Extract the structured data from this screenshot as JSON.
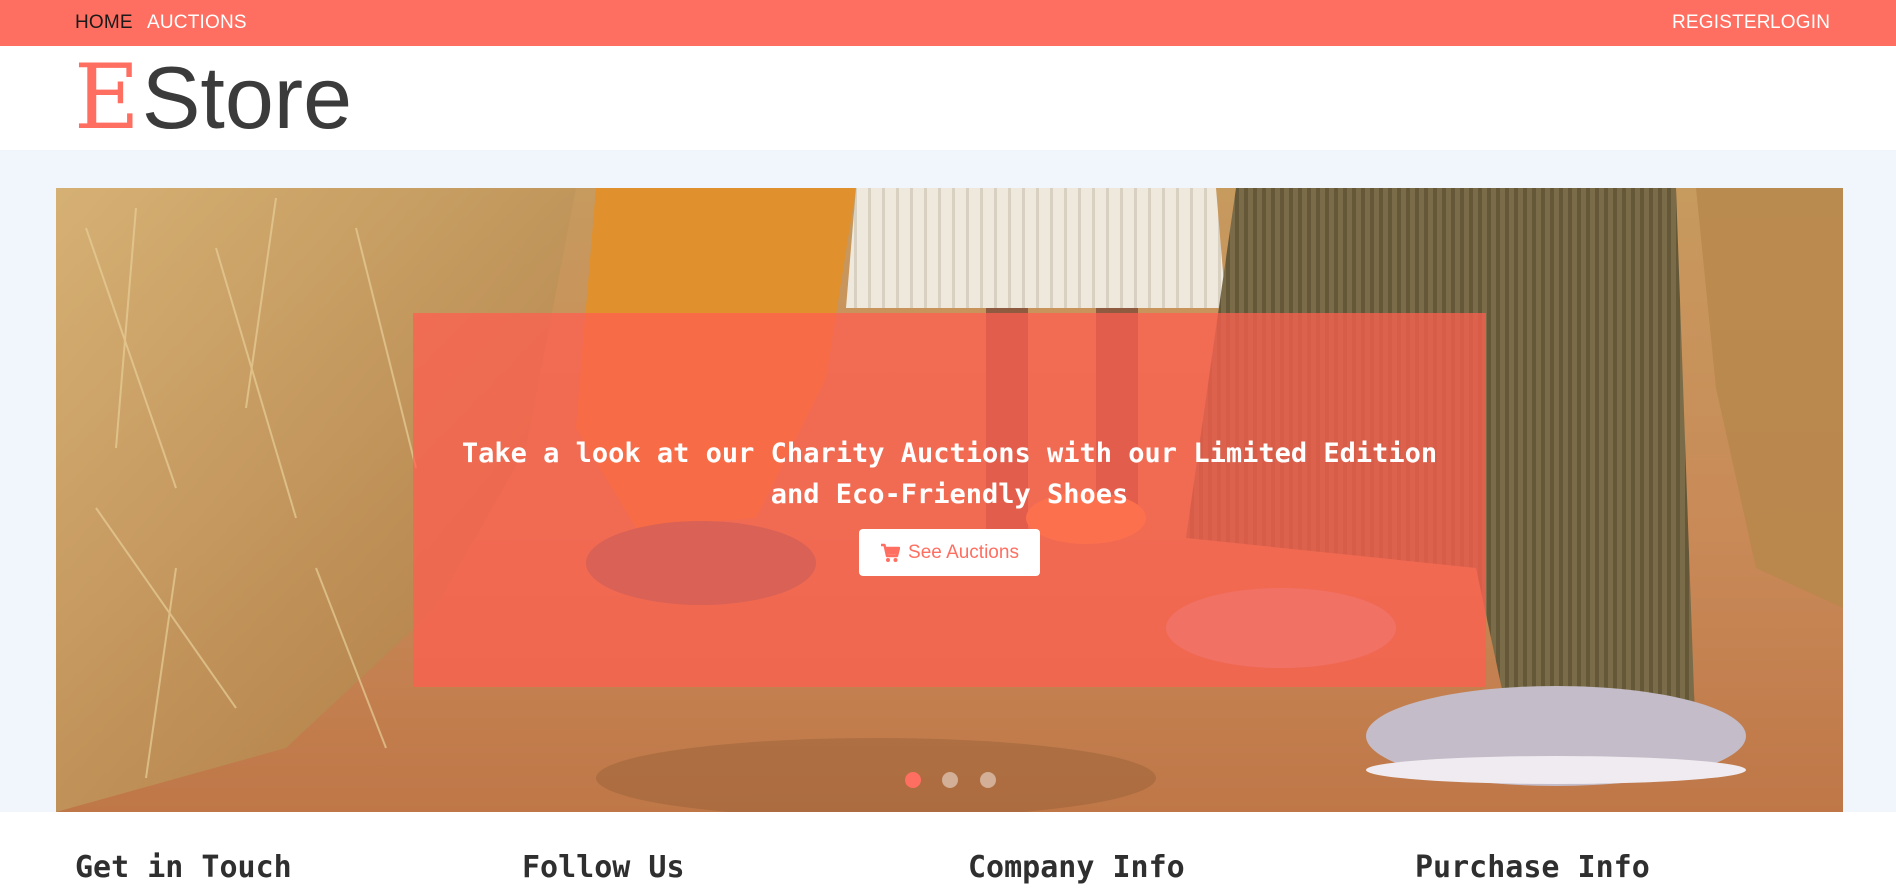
{
  "nav": {
    "left": [
      {
        "label": "HOME",
        "active": true
      },
      {
        "label": "AUCTIONS",
        "active": false
      }
    ],
    "right": [
      {
        "label": "REGISTER"
      },
      {
        "label": "LOGIN"
      }
    ]
  },
  "brand": {
    "logo_initial": "E",
    "logo_rest": "Store"
  },
  "hero": {
    "caption_line1": "Take a look at our Charity Auctions with our Limited Edition",
    "caption_line2": "and Eco-Friendly Shoes",
    "cta_label": "See Auctions",
    "cta_icon": "shopping-cart-icon",
    "slides": 3,
    "active_slide": 1
  },
  "footer": {
    "headings": [
      "Get in Touch",
      "Follow Us",
      "Company Info",
      "Purchase Info"
    ]
  },
  "colors": {
    "accent": "#ff6f61",
    "page_bg": "#f1f5fc",
    "text_dark": "#2f2f2f"
  }
}
